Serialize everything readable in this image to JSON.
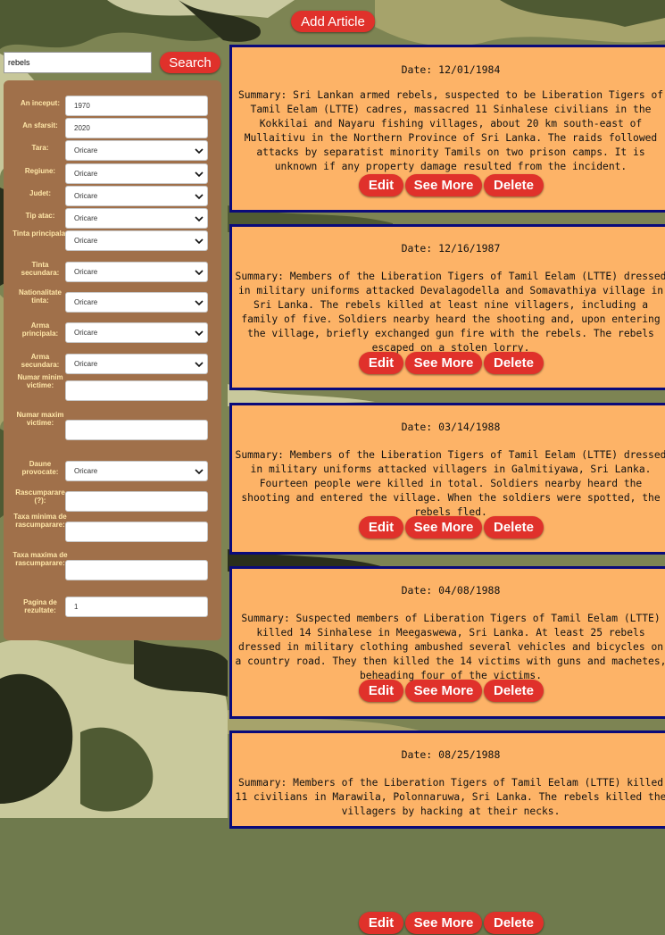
{
  "header": {
    "add_article_label": "Add Article"
  },
  "search": {
    "value": "rebels",
    "button_label": "Search"
  },
  "filters": [
    {
      "key": "an_inceput",
      "label": "An inceput:",
      "type": "input",
      "value": "1970"
    },
    {
      "key": "an_sfarsit",
      "label": "An sfarsit:",
      "type": "input",
      "value": "2020"
    },
    {
      "key": "tara",
      "label": "Tara:",
      "type": "select",
      "value": "Oricare"
    },
    {
      "key": "regiune",
      "label": "Regiune:",
      "type": "select",
      "value": "Oricare"
    },
    {
      "key": "judet",
      "label": "Judet:",
      "type": "select",
      "value": "Oricare"
    },
    {
      "key": "tip_atac",
      "label": "Tip atac:",
      "type": "select",
      "value": "Oricare"
    },
    {
      "key": "tinta_principala",
      "label": "Tinta principala:",
      "type": "select",
      "value": "Oricare"
    },
    {
      "key": "tinta_secundara",
      "label": "Tinta secundara:",
      "type": "select",
      "value": "Oricare"
    },
    {
      "key": "nationalitate_tinta",
      "label": "Nationalitate tinta:",
      "type": "select",
      "value": "Oricare"
    },
    {
      "key": "arma_principala",
      "label": "Arma principala:",
      "type": "select",
      "value": "Oricare"
    },
    {
      "key": "arma_secundara",
      "label": "Arma secundara:",
      "type": "select",
      "value": "Oricare"
    },
    {
      "key": "numar_minim_victime",
      "label": "Numar minim victime:",
      "type": "input",
      "value": ""
    },
    {
      "key": "numar_maxim_victime",
      "label": "Numar maxim victime:",
      "type": "input",
      "value": ""
    },
    {
      "key": "daune_provocate",
      "label": "Daune provocate:",
      "type": "select",
      "value": "Oricare"
    },
    {
      "key": "rascumparare",
      "label": "Rascumparare (?):",
      "type": "input",
      "value": ""
    },
    {
      "key": "taxa_minima",
      "label": "Taxa minima de rascumparare:",
      "type": "input",
      "value": ""
    },
    {
      "key": "taxa_maxima",
      "label": "Taxa maxima de rascumparare:",
      "type": "input",
      "value": ""
    },
    {
      "key": "pagina",
      "label": "Pagina de rezultate:",
      "type": "input",
      "value": "1"
    }
  ],
  "article_actions": {
    "edit": "Edit",
    "see_more": "See More",
    "delete": "Delete"
  },
  "articles": [
    {
      "date": "Date: 12/01/1984",
      "summary": "Summary: Sri Lankan armed rebels, suspected to be Liberation Tigers of Tamil Eelam (LTTE) cadres, massacred 11 Sinhalese civilians in the Kokkilai and Nayaru fishing villages, about 20 km south-east of Mullaitivu in the Northern Province of Sri Lanka. The raids followed attacks by separatist minority Tamils on two prison camps. It is unknown if any property damage resulted from the incident."
    },
    {
      "date": "Date: 12/16/1987",
      "summary": "Summary: Members of the Liberation Tigers of Tamil Eelam (LTTE) dressed in military uniforms attacked Devalagodella and Somavathiya village in Sri Lanka. The rebels killed at least nine villagers, including a family of five. Soldiers nearby heard the shooting and, upon entering the village, briefly exchanged gun fire with the rebels. The rebels escaped on a stolen lorry."
    },
    {
      "date": "Date: 03/14/1988",
      "summary": "Summary: Members of the Liberation Tigers of Tamil Eelam (LTTE) dressed in military uniforms attacked villagers in Galmitiyawa, Sri Lanka. Fourteen people were killed in total. Soldiers nearby heard the shooting and entered the village. When the soldiers were spotted, the rebels fled."
    },
    {
      "date": "Date: 04/08/1988",
      "summary": "Summary: Suspected members of Liberation Tigers of Tamil Eelam (LTTE) killed 14 Sinhalese in Meegaswewa, Sri Lanka. At least 25 rebels dressed in military clothing ambushed several vehicles and bicycles on a country road. They then killed the 14 victims with guns and machetes, beheading four of the victims."
    },
    {
      "date": "Date: 08/25/1988",
      "summary": "Summary: Members of the Liberation Tigers of Tamil Eelam (LTTE) killed 11 civilians in Marawila, Polonnaruwa, Sri Lanka. The rebels killed the villagers by hacking at their necks."
    }
  ]
}
